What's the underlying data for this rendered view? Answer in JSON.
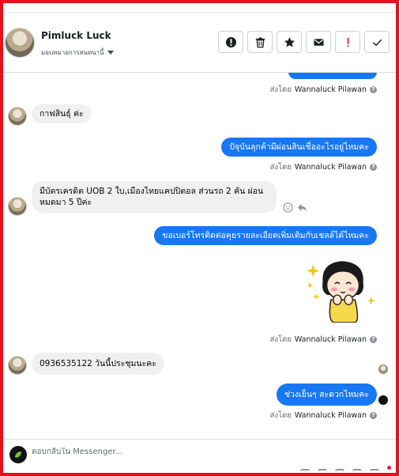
{
  "header": {
    "contact_name": "Pimluck Luck",
    "assign_label": "มอบหมายการสนทนานี้",
    "actions": [
      {
        "name": "info-button",
        "icon": "exclamation-circle-icon"
      },
      {
        "name": "delete-button",
        "icon": "trash-icon"
      },
      {
        "name": "star-button",
        "icon": "star-icon"
      },
      {
        "name": "mark-unread-button",
        "icon": "envelope-icon"
      },
      {
        "name": "spam-button",
        "icon": "red-exclamation-icon"
      },
      {
        "name": "done-button",
        "icon": "checkmark-icon"
      }
    ]
  },
  "messages": {
    "sent_by_prefix": "ส่งโดย",
    "agent_name": "Wannaluck Pilawan",
    "m1": "กาฟสินธุ์ ค่ะ",
    "m2": "ปัจุบันลุกค้ามีผ่อนสินเชื่ออะไรอยู่ไหมคะ",
    "m3": "มีบัตรเครดิต UOB 2 ใบ,เมืองไทยแคปปิตอล ส่วนรถ 2 คัน ผ่อนหมดมา 5 ปีค่ะ",
    "m4": "ขอเบอร์โทรติดต่อคุยรายละเอียดเพิ่มเติมกับเชลล์ได้ไหมคะ",
    "m5": "0936535122 วันนี้ประชุมนะคะ",
    "m6": "ช่วงเย็นๆ สะดวกไหมคะ"
  },
  "composer": {
    "placeholder": "ตอบกลับใน Messenger..."
  },
  "colors": {
    "accent": "#1877f2",
    "frame": "#e8101b",
    "incoming_bubble": "#f0f0f0"
  }
}
